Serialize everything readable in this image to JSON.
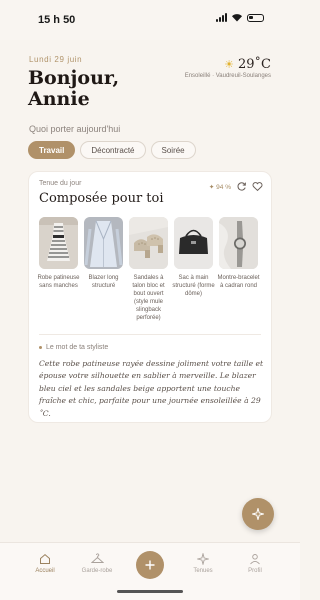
{
  "status": {
    "time": "15 h 50"
  },
  "header": {
    "date": "Lundi 29 juin",
    "greeting_line1": "Bonjour,",
    "greeting_line2": "Annie",
    "temperature": "29˚C",
    "weather_icon": "sun-icon",
    "location": "Ensoleillé · Vaudreuil-Soulanges"
  },
  "occasion": {
    "prompt": "Quoi porter aujourd'hui",
    "chips": [
      {
        "label": "Travail",
        "active": true
      },
      {
        "label": "Décontracté",
        "active": false
      },
      {
        "label": "Soirée",
        "active": false
      }
    ]
  },
  "outfit": {
    "eyebrow": "Tenue du jour",
    "title": "Composée pour toi",
    "match": "94 %",
    "items": [
      {
        "label": "Robe patineuse sans manches"
      },
      {
        "label": "Blazer long structuré"
      },
      {
        "label": "Sandales à talon bloc et bout ouvert (style mule slingback perforée)"
      },
      {
        "label": "Sac à main structuré (forme dôme)"
      },
      {
        "label": "Montre-bracelet à cadran rond"
      }
    ],
    "stylist_label": "Le mot de ta styliste",
    "stylist_text": "Cette robe patineuse rayée dessine joliment votre taille et épouse votre silhouette en sablier à merveille. Le blazer bleu ciel et les sandales beige apportent une touche fraîche et chic, parfaite pour une journée ensoleillée à 29 ˚C."
  },
  "nav": {
    "items": [
      {
        "label": "Accueil",
        "icon": "home-icon",
        "active": true
      },
      {
        "label": "Garde-robe",
        "icon": "hanger-icon",
        "active": false
      },
      {
        "label": "Tenues",
        "icon": "sparkle-icon",
        "active": false
      },
      {
        "label": "Profil",
        "icon": "person-icon",
        "active": false
      }
    ],
    "center_icon": "plus-icon"
  },
  "colors": {
    "accent": "#b09169",
    "background": "#f8f4ef"
  }
}
